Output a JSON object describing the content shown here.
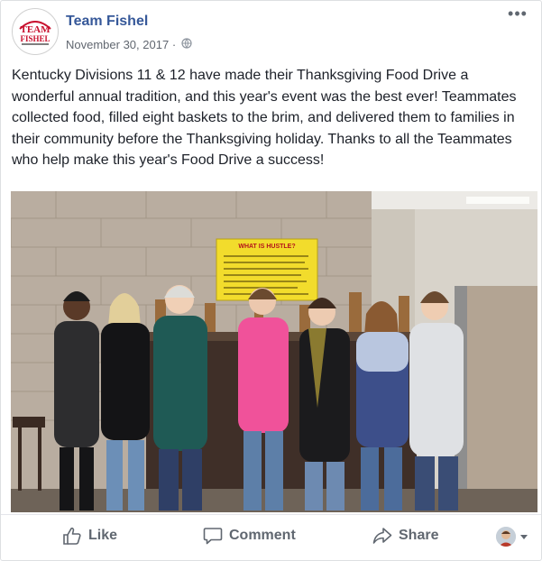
{
  "post": {
    "author": "Team Fishel",
    "logo_text": [
      "TEAM",
      "FISHEL"
    ],
    "date": "November 30, 2017",
    "date_separator": "·",
    "text": "Kentucky Divisions 11 & 12 have made their Thanksgiving Food Drive a wonderful annual tradition, and this year's event was the best ever! Teammates collected food, filled eight baskets to the brim, and delivered them to families in their community before the Thanksgiving holiday. Thanks to all the Teammates who help make this year's Food Drive a success!",
    "photo": {
      "poster_title": "WHAT IS HUSTLE?"
    }
  },
  "actions": {
    "like_label": "Like",
    "comment_label": "Comment",
    "share_label": "Share"
  },
  "colors": {
    "link_blue": "#365899",
    "action_gray": "#606770",
    "brand_red": "#c8102e"
  },
  "icons": [
    "more-options-icon",
    "globe-icon",
    "like-icon",
    "comment-icon",
    "share-icon",
    "chevron-down-icon"
  ]
}
